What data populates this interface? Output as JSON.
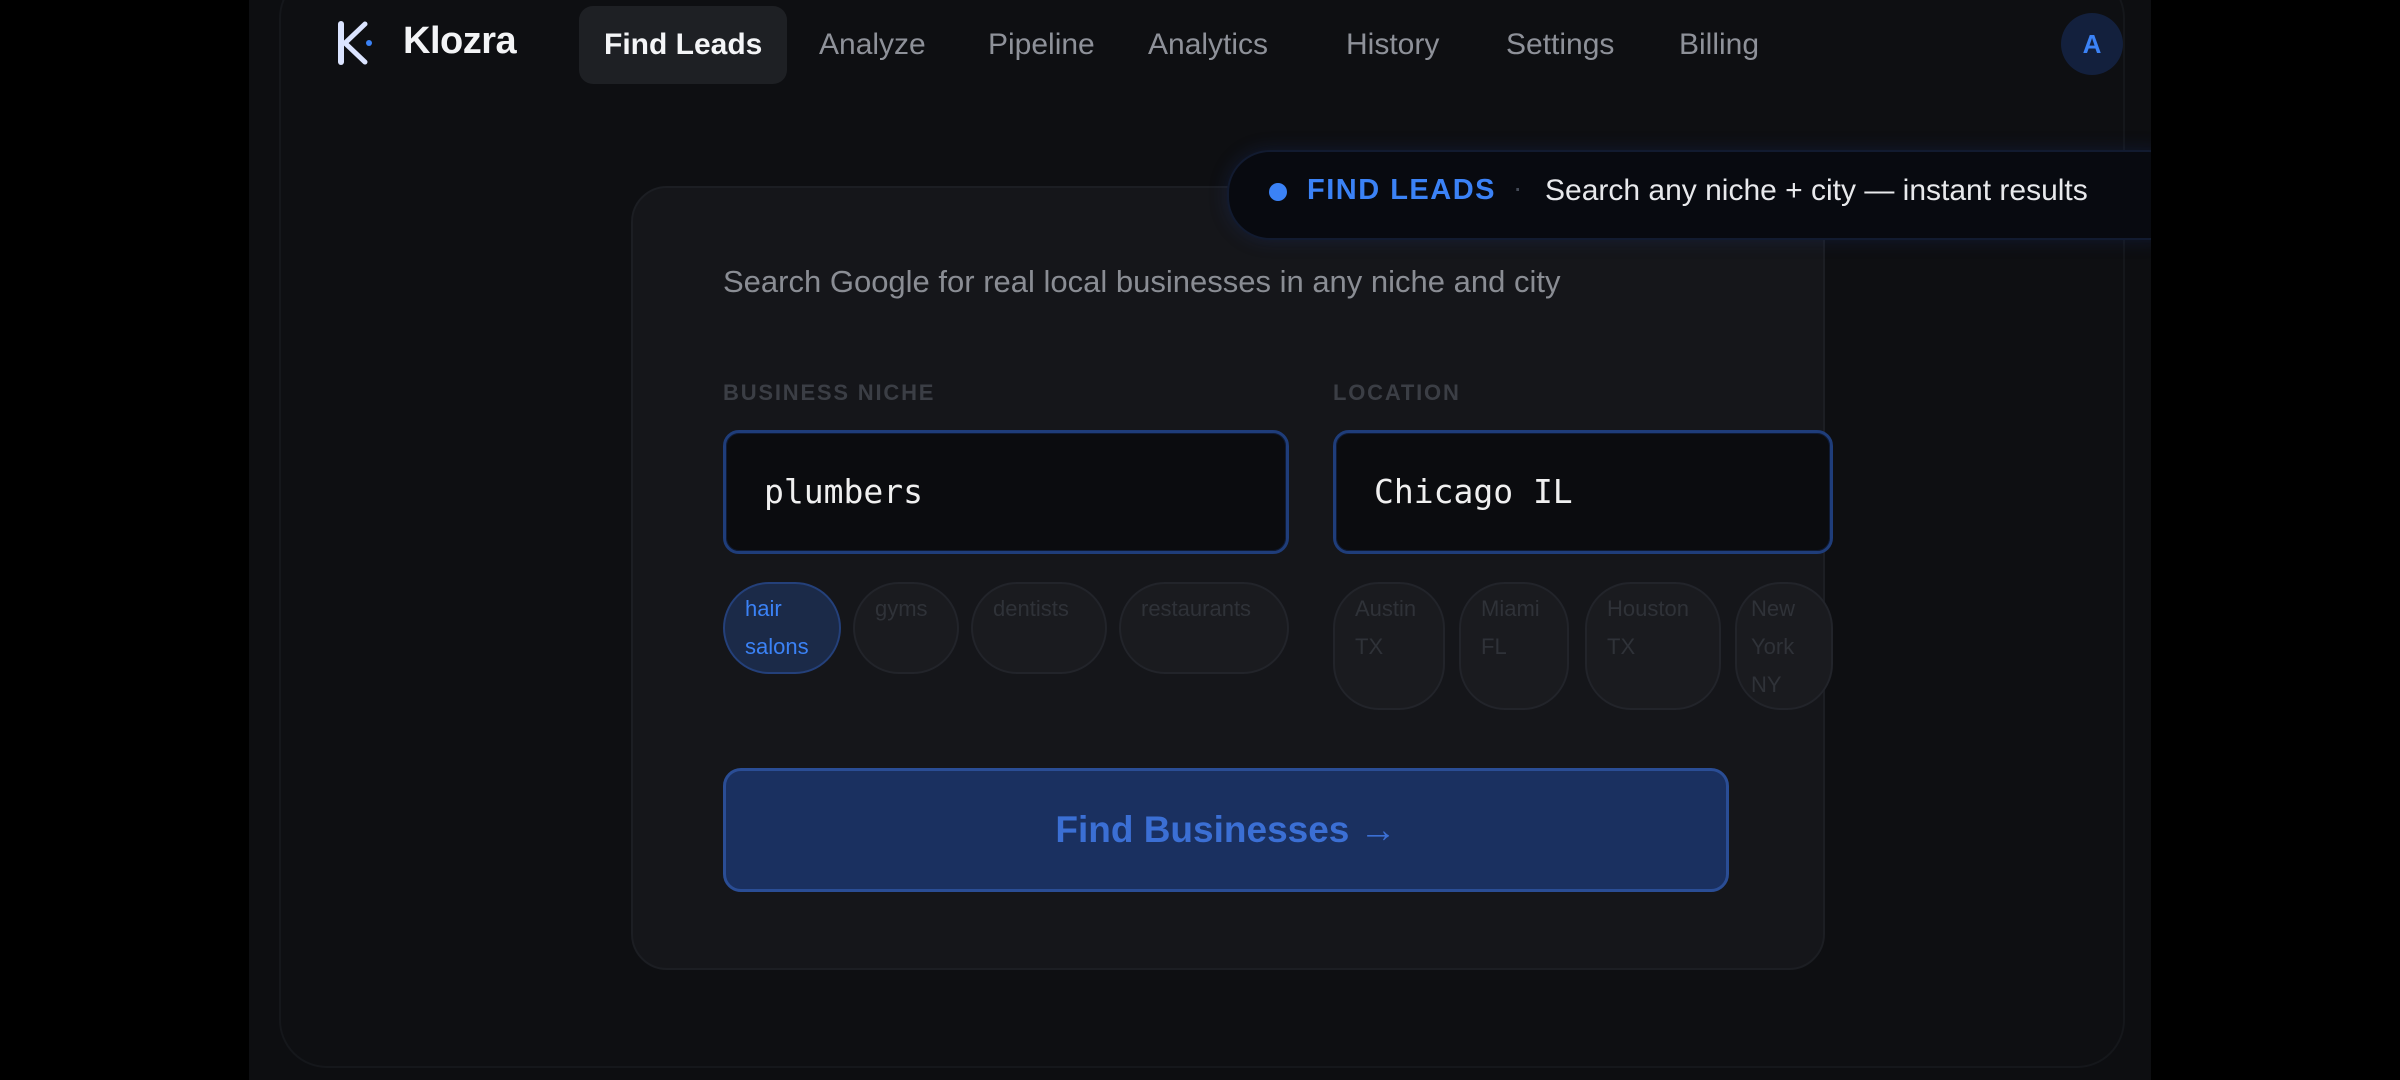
{
  "app": {
    "brand": "Klozra",
    "avatar_initial": "A",
    "accent_color": "#3b82f6"
  },
  "nav": {
    "items": [
      {
        "label": "Find Leads",
        "active": true
      },
      {
        "label": "Analyze",
        "active": false
      },
      {
        "label": "Pipeline",
        "active": false
      },
      {
        "label": "Analytics",
        "active": false
      },
      {
        "label": "History",
        "active": false
      },
      {
        "label": "Settings",
        "active": false
      },
      {
        "label": "Billing",
        "active": false
      }
    ]
  },
  "banner": {
    "label": "FIND LEADS",
    "separator": "·",
    "text": "Search any niche + city — instant results"
  },
  "form": {
    "description": "Search Google for real local businesses in any niche and city",
    "niche": {
      "label": "BUSINESS NICHE",
      "value": "plumbers",
      "suggestions": [
        "hair salons",
        "gyms",
        "dentists",
        "restaurants"
      ]
    },
    "location": {
      "label": "LOCATION",
      "value": "Chicago IL",
      "suggestions": [
        "Austin TX",
        "Miami FL",
        "Houston TX",
        "New York NY"
      ]
    },
    "submit_label": "Find Businesses →"
  }
}
